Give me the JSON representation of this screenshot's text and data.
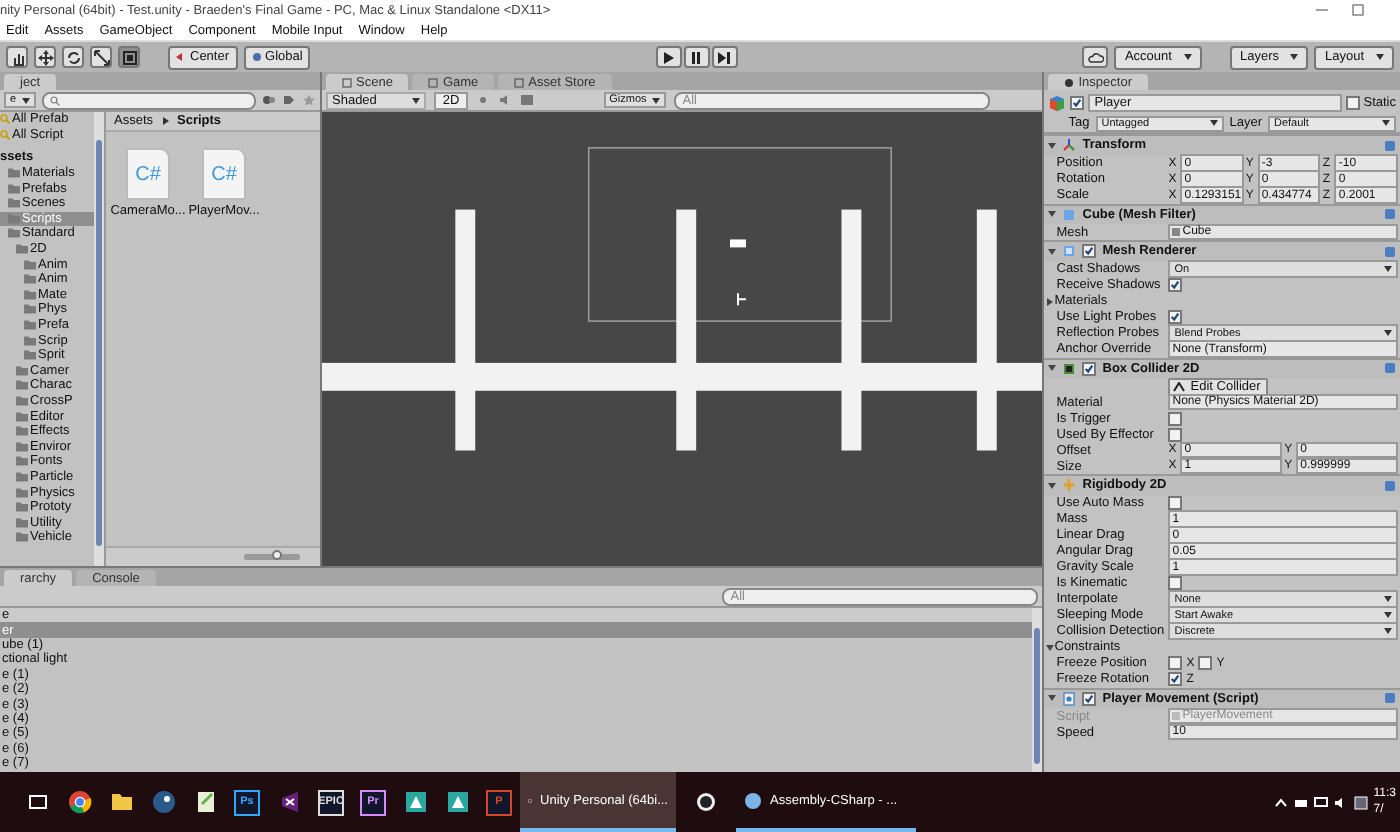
{
  "window": {
    "title": "nity Personal (64bit) - Test.unity - Braeden's Final Game - PC, Mac & Linux Standalone <DX11>"
  },
  "menu": [
    "Edit",
    "Assets",
    "GameObject",
    "Component",
    "Mobile Input",
    "Window",
    "Help"
  ],
  "toolbar": {
    "tools": [
      {
        "kind": "hand",
        "selected": false
      },
      {
        "kind": "move",
        "selected": false
      },
      {
        "kind": "rotate",
        "selected": false
      },
      {
        "kind": "scale",
        "selected": false
      },
      {
        "kind": "rect",
        "selected": true
      }
    ],
    "pivot": [
      {
        "kind": "pivot",
        "label": "Center"
      },
      {
        "kind": "global",
        "label": "Global"
      }
    ],
    "playback": [
      {
        "kind": "play"
      },
      {
        "kind": "pause"
      },
      {
        "kind": "step"
      }
    ],
    "account": "Account",
    "layers": "Layers",
    "layout": "Layout"
  },
  "project": {
    "tab": "ject",
    "create": "e",
    "favorites": [
      {
        "label": "All Prefab",
        "selected": false
      },
      {
        "label": "All Script",
        "selected": false
      }
    ],
    "tree": [
      {
        "label": "ssets",
        "selected": false,
        "children": [
          {
            "label": "Materials",
            "selected": false
          },
          {
            "label": "Prefabs",
            "selected": false
          },
          {
            "label": "Scenes",
            "selected": false
          },
          {
            "label": "Scripts",
            "selected": true
          },
          {
            "label": "Standard",
            "selected": false,
            "children": [
              {
                "label": "2D",
                "selected": false,
                "children": [
                  {
                    "label": "Anim",
                    "selected": false
                  },
                  {
                    "label": "Anim",
                    "selected": false
                  },
                  {
                    "label": "Mate",
                    "selected": false
                  },
                  {
                    "label": "Phys",
                    "selected": false
                  },
                  {
                    "label": "Prefa",
                    "selected": false
                  },
                  {
                    "label": "Scrip",
                    "selected": false
                  },
                  {
                    "label": "Sprit",
                    "selected": false
                  }
                ]
              },
              {
                "label": "Camer",
                "selected": false
              },
              {
                "label": "Charac",
                "selected": false
              },
              {
                "label": "CrossP",
                "selected": false
              },
              {
                "label": "Editor",
                "selected": false
              },
              {
                "label": "Effects",
                "selected": false
              },
              {
                "label": "Enviror",
                "selected": false
              },
              {
                "label": "Fonts",
                "selected": false
              },
              {
                "label": "Particle",
                "selected": false
              },
              {
                "label": "Physics",
                "selected": false
              },
              {
                "label": "Prototy",
                "selected": false
              },
              {
                "label": "Utility",
                "selected": false
              },
              {
                "label": "Vehicle",
                "selected": false
              }
            ]
          }
        ]
      }
    ],
    "breadcrumb": [
      "Assets",
      "Scripts"
    ],
    "files": [
      {
        "name": "CameraMo...",
        "badge": "C#"
      },
      {
        "name": "PlayerMov...",
        "badge": "C#"
      }
    ],
    "icon_size": {
      "level": 0.6
    }
  },
  "scene": {
    "tabs": [
      {
        "label": "Scene",
        "selected": true
      },
      {
        "label": "Game",
        "selected": false
      },
      {
        "label": "Asset Store",
        "selected": false
      }
    ],
    "shading": "Shaded",
    "mode": "2D",
    "gizmos": "Gizmos",
    "search": {
      "placeholder": "All"
    }
  },
  "inspector": {
    "tab": "Inspector",
    "object": {
      "active": true,
      "name": "Player",
      "static_label": "Static",
      "static": false
    },
    "tag_label": "Tag",
    "tag": "Untagged",
    "layer_label": "Layer",
    "layer": "Default",
    "components": [
      {
        "kind": "transform",
        "title": "Transform",
        "expanded": true,
        "rows": [
          {
            "kind": "vector",
            "label": "Position",
            "fields": [
              {
                "axis": "X",
                "value": "0"
              },
              {
                "axis": "Y",
                "value": "-3"
              },
              {
                "axis": "Z",
                "value": "-10"
              }
            ]
          },
          {
            "kind": "vector",
            "label": "Rotation",
            "fields": [
              {
                "axis": "X",
                "value": "0"
              },
              {
                "axis": "Y",
                "value": "0"
              },
              {
                "axis": "Z",
                "value": "0"
              }
            ]
          },
          {
            "kind": "vector",
            "label": "Scale",
            "fields": [
              {
                "axis": "X",
                "value": "0.1293151"
              },
              {
                "axis": "Y",
                "value": "0.434774"
              },
              {
                "axis": "Z",
                "value": "0.2001"
              }
            ]
          }
        ]
      },
      {
        "kind": "meshfilter",
        "title": "Cube (Mesh Filter)",
        "expanded": true,
        "rows": [
          {
            "kind": "object",
            "label": "Mesh",
            "value": "Cube"
          }
        ]
      },
      {
        "kind": "renderer",
        "title": "Mesh Renderer",
        "expanded": true,
        "enabled": true,
        "rows": [
          {
            "kind": "dropdown",
            "label": "Cast Shadows",
            "value": "On"
          },
          {
            "kind": "checkbox",
            "label": "Receive Shadows",
            "checked": true
          },
          {
            "kind": "foldout",
            "label": "Materials",
            "expanded": false
          },
          {
            "kind": "checkbox",
            "label": "Use Light Probes",
            "checked": true
          },
          {
            "kind": "dropdown",
            "label": "Reflection Probes",
            "value": "Blend Probes"
          },
          {
            "kind": "field",
            "label": "Anchor Override",
            "value": "None (Transform)"
          }
        ]
      },
      {
        "kind": "collider",
        "title": "Box Collider 2D",
        "expanded": true,
        "enabled": true,
        "rows": [
          {
            "kind": "button",
            "label": "Edit Collider"
          },
          {
            "kind": "field",
            "label": "Material",
            "value": "None (Physics Material 2D)"
          },
          {
            "kind": "checkbox",
            "label": "Is Trigger",
            "checked": false
          },
          {
            "kind": "checkbox",
            "label": "Used By Effector",
            "checked": false
          },
          {
            "kind": "vector",
            "label": "Offset",
            "fields": [
              {
                "axis": "X",
                "value": "0"
              },
              {
                "axis": "Y",
                "value": "0"
              }
            ]
          },
          {
            "kind": "vector",
            "label": "Size",
            "fields": [
              {
                "axis": "X",
                "value": "1"
              },
              {
                "axis": "Y",
                "value": "0.999999"
              }
            ]
          }
        ]
      },
      {
        "kind": "rigidbody",
        "title": "Rigidbody 2D",
        "expanded": true,
        "rows": [
          {
            "kind": "checkbox",
            "label": "Use Auto Mass",
            "checked": false
          },
          {
            "kind": "field",
            "label": "Mass",
            "value": "1"
          },
          {
            "kind": "field",
            "label": "Linear Drag",
            "value": "0"
          },
          {
            "kind": "field",
            "label": "Angular Drag",
            "value": "0.05"
          },
          {
            "kind": "field",
            "label": "Gravity Scale",
            "value": "1"
          },
          {
            "kind": "checkbox",
            "label": "Is Kinematic",
            "checked": false
          },
          {
            "kind": "dropdown",
            "label": "Interpolate",
            "value": "None"
          },
          {
            "kind": "dropdown",
            "label": "Sleeping Mode",
            "value": "Start Awake"
          },
          {
            "kind": "dropdown",
            "label": "Collision Detection",
            "value": "Discrete"
          },
          {
            "kind": "foldout",
            "label": "Constraints",
            "expanded": true
          },
          {
            "kind": "checks",
            "label": "Freeze Position",
            "items": [
              {
                "axis": "X",
                "checked": false
              },
              {
                "axis": "Y",
                "checked": false
              }
            ]
          },
          {
            "kind": "checks",
            "label": "Freeze Rotation",
            "items": [
              {
                "axis": "Z",
                "checked": true
              }
            ]
          }
        ]
      },
      {
        "kind": "script",
        "title": "Player Movement (Script)",
        "expanded": true,
        "enabled": true,
        "rows": [
          {
            "kind": "script",
            "label": "Script",
            "value": "PlayerMovement"
          },
          {
            "kind": "field",
            "label": "Speed",
            "value": "10"
          }
        ]
      }
    ]
  },
  "hierarchy": {
    "tabs": [
      {
        "label": "rarchy",
        "selected": true
      },
      {
        "label": "Console",
        "selected": false
      }
    ],
    "search": {
      "placeholder": "All"
    },
    "items": [
      {
        "kind": "scene",
        "label": "e",
        "selected": false
      },
      {
        "kind": "object",
        "label": "er",
        "selected": true
      },
      {
        "kind": "object",
        "label": "ube (1)",
        "selected": false
      },
      {
        "kind": "object",
        "label": "ctional light",
        "selected": false
      },
      {
        "kind": "object",
        "label": "e (1)",
        "selected": false
      },
      {
        "kind": "object",
        "label": "e (2)",
        "selected": false
      },
      {
        "kind": "object",
        "label": "e (3)",
        "selected": false
      },
      {
        "kind": "object",
        "label": "e (4)",
        "selected": false
      },
      {
        "kind": "object",
        "label": "e (5)",
        "selected": false
      },
      {
        "kind": "object",
        "label": "e (6)",
        "selected": false
      },
      {
        "kind": "object",
        "label": "e (7)",
        "selected": false
      }
    ]
  },
  "taskbar": {
    "apps": [
      {
        "kind": "taskview"
      },
      {
        "kind": "chrome"
      },
      {
        "kind": "folder"
      },
      {
        "kind": "steam"
      },
      {
        "kind": "notepad"
      },
      {
        "kind": "tile",
        "text": "Ps",
        "color": "#31a8ff"
      },
      {
        "kind": "vs"
      },
      {
        "kind": "tile",
        "text": "EPIC",
        "color": "#dddddd"
      },
      {
        "kind": "tile",
        "text": "Pr",
        "color": "#d58cff"
      },
      {
        "kind": "teal"
      },
      {
        "kind": "teal"
      },
      {
        "kind": "tile",
        "text": "P",
        "color": "#d24726"
      }
    ],
    "windows": [
      {
        "kind": "unity",
        "label": "Unity Personal (64bi...",
        "selected": true
      },
      {
        "kind": "unreal"
      },
      {
        "kind": "vsproject",
        "label": "Assembly-CSharp - ...",
        "selected": false
      }
    ],
    "clock": [
      "11:3",
      "7/"
    ]
  }
}
